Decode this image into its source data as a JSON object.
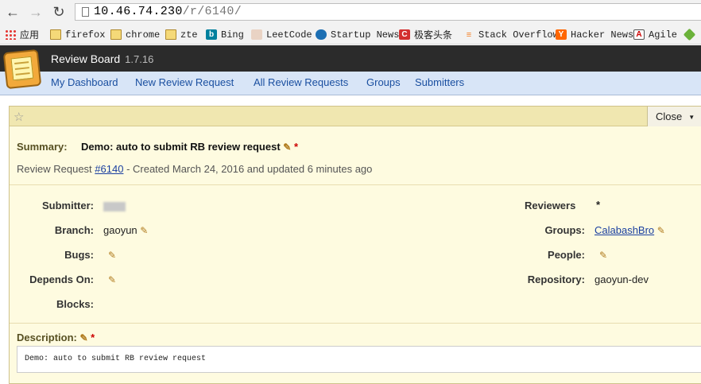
{
  "browser": {
    "back_icon": "arrow-left-icon",
    "forward_icon": "arrow-right-icon",
    "reload_icon": "reload-icon",
    "url_host": "10.46.74.230",
    "url_path": "/r/6140/",
    "bookmarks": [
      {
        "label": "应用",
        "icon": "apps-grid-icon"
      },
      {
        "label": "firefox",
        "icon": "folder-icon"
      },
      {
        "label": "chrome",
        "icon": "folder-icon"
      },
      {
        "label": "zte",
        "icon": "folder-icon"
      },
      {
        "label": "Bing",
        "icon": "bing-icon"
      },
      {
        "label": "LeetCode",
        "icon": "leetcode-icon"
      },
      {
        "label": "Startup News",
        "icon": "startup-news-icon"
      },
      {
        "label": "极客头条",
        "icon": "geek-icon"
      },
      {
        "label": "Stack Overflow",
        "icon": "stack-overflow-icon"
      },
      {
        "label": "Hacker News",
        "icon": "hacker-news-icon"
      },
      {
        "label": "Agile",
        "icon": "agile-icon"
      }
    ]
  },
  "app": {
    "title": "Review Board",
    "version": "1.7.16",
    "nav": [
      "My Dashboard",
      "New Review Request",
      "All Review Requests",
      "Groups",
      "Submitters"
    ]
  },
  "review": {
    "close_label": "Close",
    "summary_label": "Summary:",
    "summary": "Demo: auto to submit RB review request",
    "required_mark": "*",
    "subline_prefix": "Review Request",
    "request_id": "#6140",
    "subline_suffix": "- Created March 24, 2016 and updated 6 minutes ago",
    "left_fields": [
      {
        "label": "Submitter:",
        "value": ""
      },
      {
        "label": "Branch:",
        "value": "gaoyun"
      },
      {
        "label": "Bugs:",
        "value": ""
      },
      {
        "label": "Depends On:",
        "value": ""
      },
      {
        "label": "Blocks:",
        "value": ""
      }
    ],
    "reviewers_label": "Reviewers",
    "right_fields": [
      {
        "label": "Groups:",
        "value": "CalabashBro"
      },
      {
        "label": "People:",
        "value": ""
      },
      {
        "label": "Repository:",
        "value": "gaoyun-dev"
      }
    ],
    "description_label": "Description:",
    "description": "Demo: auto to submit RB review request"
  },
  "colors": {
    "header_bg": "#2b2b2b",
    "nav_bg": "#d8e5f7",
    "link": "#1a4fa0",
    "box_bg": "#fefbe0",
    "required": "#cc0000"
  }
}
